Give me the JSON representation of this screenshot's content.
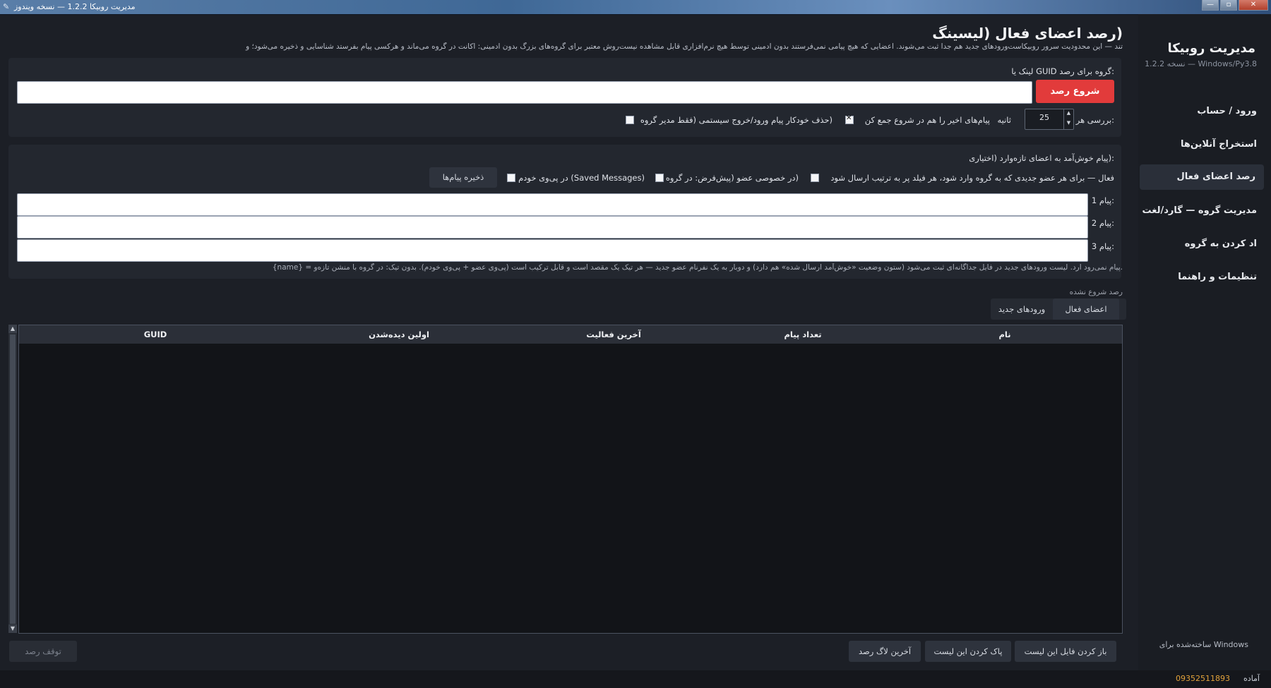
{
  "window": {
    "title": "مدیریت روبیکا 1.2.2 — نسخه ویندوز",
    "minimize": "—",
    "maximize": "▫",
    "close": "✕"
  },
  "sidebar": {
    "brand": "مدیریت روبیکا",
    "version": "1.2.2 نسخه — Windows/Py3.8",
    "items": [
      {
        "label": "ورود / حساب"
      },
      {
        "label": "استخراج آنلاین‌ها"
      },
      {
        "label": "رصد اعضای فعال"
      },
      {
        "label": "مدیریت گروه — گارد/لغت"
      },
      {
        "label": "اد کردن به گروه"
      },
      {
        "label": "تنظیمات و راهنما"
      }
    ],
    "footer": "ساخته‌شده برای Windows"
  },
  "status": {
    "ready": "آماده",
    "phone": "09352511893"
  },
  "header": {
    "title": "(رصد اعضای فعال (لیسینگ",
    "description": "تند — این محدودیت سرور روبیکاست‌ورودهای جدید هم جدا ثبت می‌شوند. اعضایی که هیچ پیامی نمی‌فرستند بدون ادمینی توسط هیچ نرم‌افزاری قابل مشاهده نیست‌روش معتبر برای گروه‌های بزرگ بدون ادمینی: اکانت در گروه می‌ماند و هرکسی پیام بفرستد شناسایی و ذخیره می‌شود؛ و"
  },
  "monitor": {
    "group_label": ":گروه برای رصد GUID لینک یا",
    "group_input_value": "",
    "start_button": "شروع رصد",
    "interval_label": ":بررسی هر",
    "interval_value": "25",
    "seconds_label": "ثانیه",
    "collect_recent_label": "پیام‌های اخیر را هم در شروع جمع کن",
    "collect_recent_checked": true,
    "auto_delete_label": "(حذف خودکار پیام ورود/خروج سیستمی (فقط مدیر گروه",
    "auto_delete_checked": false
  },
  "welcome": {
    "title": ":(پیام خوش‌آمد به اعضای تازه‌وارد (اختیاری",
    "active_label": "فعال — برای هر عضو جدیدی که به گروه وارد شود، هر فیلد پر به ترتیب ارسال شود",
    "active_checked": false,
    "private_label": "(در خصوصی عضو (پیش‌فرض: در گروه",
    "private_checked": false,
    "saved_label": "(Saved Messages) در پی‌وی خودم",
    "saved_checked": false,
    "save_button": "ذخیره پیام‌ها",
    "msg1_label": ":پیام 1",
    "msg2_label": ":پیام 2",
    "msg3_label": ":پیام 3",
    "msg1_value": "",
    "msg2_value": "",
    "msg3_value": "",
    "hint": ".پیام نمی‌رود ارد. لیست ورودهای جدید در فایل جداگانه‌ای ثبت می‌شود (ستون وضعیت «خوش‌آمد ارسال شده» هم دارد) و دوبار به یک نفرنام عضو جدید — هر تیک یک مقصد است و قابل ترکیب است (پی‌وی عضو + پی‌وی خودم). بدون تیک: در گروه با منشن تازه‌و = {name}"
  },
  "results": {
    "state_label": "رصد شروع نشده",
    "tabs": [
      {
        "label": "اعضای فعال"
      },
      {
        "label": "ورودهای جدید"
      }
    ],
    "columns": [
      "نام",
      "تعداد پیام",
      "آخرین فعالیت",
      "اولین دیده‌شدن",
      "GUID"
    ]
  },
  "bottom": {
    "open_file": "باز کردن فایل این لیست",
    "clear_list": "پاک کردن این لیست",
    "last_log": "آخرین لاگ رصد",
    "stop": "توقف رصد"
  },
  "colors": {
    "accent": "#e23b3b",
    "background": "#1c1f26",
    "phone": "#e2a23a"
  }
}
